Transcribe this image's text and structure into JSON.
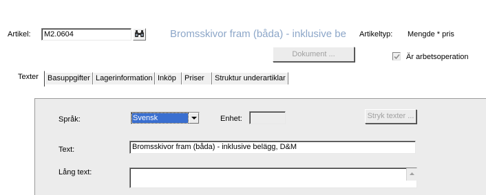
{
  "header": {
    "artikel_label": "Artikel:",
    "artikel_value": "M2.0604",
    "title": "Bromsskivor fram (båda) - inklusive be",
    "artikeltyp_label": "Artikeltyp:",
    "artikeltyp_value": "Mengde * pris",
    "dokument_button": "Dokument ...",
    "arbetsoperation_label": "Är arbetsoperation",
    "arbetsoperation_checked": true
  },
  "tabs": [
    {
      "label": "Texter",
      "active": true
    },
    {
      "label": "Basuppgifter"
    },
    {
      "label": "Lagerinformation"
    },
    {
      "label": "Inköp"
    },
    {
      "label": "Priser"
    },
    {
      "label": "Struktur underartiklar"
    }
  ],
  "texter": {
    "sprak_label": "Språk:",
    "sprak_value": "Svensk",
    "enhet_label": "Enhet:",
    "enhet_value": "",
    "stryk_button": "Stryk texter ...",
    "text_label": "Text:",
    "text_value": "Bromsskivor fram (båda) - inklusive belägg, D&M",
    "lang_text_label": "Lång text:",
    "lang_text_value": ""
  },
  "colors": {
    "title": "#8ca6c8",
    "disabled_text": "#a0a0a0",
    "selection": "#3a6fd0",
    "group_bg": "#ececec"
  }
}
